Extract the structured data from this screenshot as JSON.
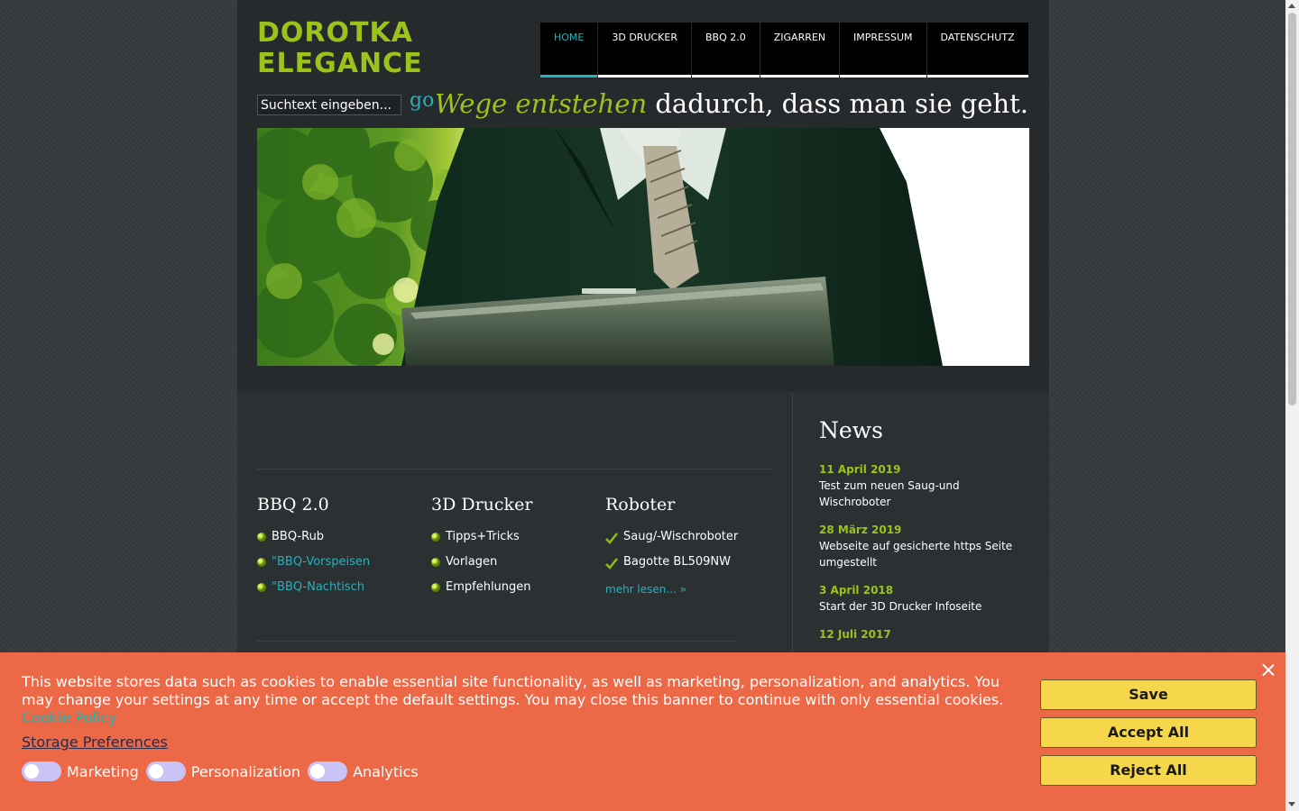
{
  "site": {
    "logo_line1": "DOROTKA",
    "logo_line2": "ELEGANCE"
  },
  "nav": {
    "items": [
      {
        "label": "HOME",
        "active": true
      },
      {
        "label": "3D DRUCKER"
      },
      {
        "label": "BBQ 2.0"
      },
      {
        "label": "ZIGARREN"
      },
      {
        "label": "IMPRESSUM"
      },
      {
        "label": "DATENSCHUTZ"
      }
    ]
  },
  "search": {
    "value": "Suchtext eingeben...",
    "go_label": "go"
  },
  "slogan": {
    "highlight": "Wege entstehen",
    "rest": " dadurch, dass man sie geht."
  },
  "columns": [
    {
      "title": "BBQ 2.0",
      "items": [
        "BBQ-Rub",
        "\"BBQ-Vorspeisen",
        "\"BBQ-Nachtisch"
      ]
    },
    {
      "title": "3D Drucker",
      "items": [
        "Tipps+Tricks",
        "Vorlagen",
        "Empfehlungen"
      ]
    },
    {
      "title": "Roboter",
      "items": [
        "Saug/-Wischroboter",
        "Bagotte BL509NW"
      ],
      "more": "mehr lesen... »"
    }
  ],
  "news": {
    "title": "News",
    "items": [
      {
        "date": "11 April 2019",
        "text": "Test zum neuen Saug-und Wischroboter"
      },
      {
        "date": "28 März 2019",
        "text": "Webseite auf gesicherte https Seite umgestellt"
      },
      {
        "date": "3 April 2018",
        "text": "Start der 3D Drucker Infoseite"
      },
      {
        "date": "12 Juli 2017",
        "text": ""
      }
    ]
  },
  "cookie": {
    "text": "This website stores data such as cookies to enable essential site functionality, as well as marketing, personalization, and analytics. You may change your settings at any time or accept the default settings. You may close this banner to continue with only essential cookies.",
    "policy_link": "Cookie Policy",
    "storage_link": "Storage Preferences",
    "toggles": [
      "Marketing",
      "Personalization",
      "Analytics"
    ],
    "buttons": {
      "save": "Save",
      "accept": "Accept All",
      "reject": "Reject All"
    }
  },
  "colors": {
    "accent_green": "#9bc31c",
    "accent_teal": "#27b1bd",
    "banner": "#ec6847",
    "button": "#f6d64a"
  }
}
